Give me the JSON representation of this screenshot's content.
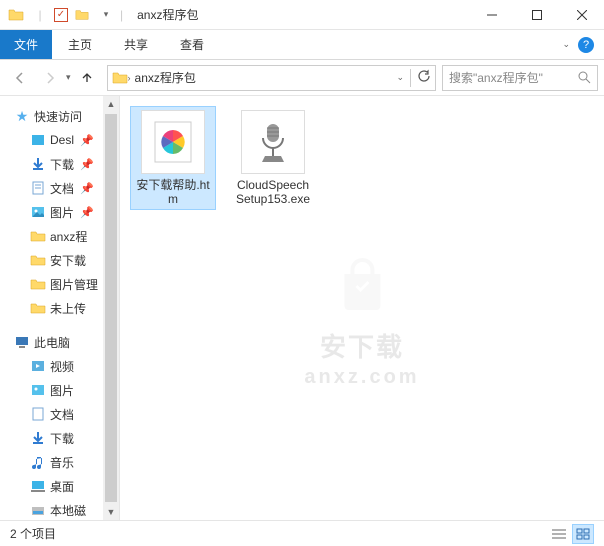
{
  "titlebar": {
    "title": "anxz程序包"
  },
  "ribbon": {
    "file": "文件",
    "tabs": [
      "主页",
      "共享",
      "查看"
    ]
  },
  "nav": {
    "address": "anxz程序包",
    "search_placeholder": "搜索\"anxz程序包\""
  },
  "sidebar": {
    "quick_access": "快速访问",
    "items1": [
      {
        "label": "Desl",
        "pin": true
      },
      {
        "label": "下载",
        "pin": true
      },
      {
        "label": "文档",
        "pin": true
      },
      {
        "label": "图片",
        "pin": true
      },
      {
        "label": "anxz程"
      },
      {
        "label": "安下载"
      },
      {
        "label": "图片管理"
      },
      {
        "label": "未上传"
      }
    ],
    "this_pc": "此电脑",
    "items2": [
      {
        "label": "视频"
      },
      {
        "label": "图片"
      },
      {
        "label": "文档"
      },
      {
        "label": "下载"
      },
      {
        "label": "音乐"
      },
      {
        "label": "桌面"
      },
      {
        "label": "本地磁"
      }
    ]
  },
  "files": [
    {
      "name": "安下载帮助.htm",
      "selected": true,
      "type": "htm"
    },
    {
      "name": "CloudSpeechSetup153.exe",
      "selected": false,
      "type": "exe"
    }
  ],
  "watermark": {
    "line1": "安下载",
    "line2": "anxz.com"
  },
  "status": {
    "count": "2 个项目"
  }
}
